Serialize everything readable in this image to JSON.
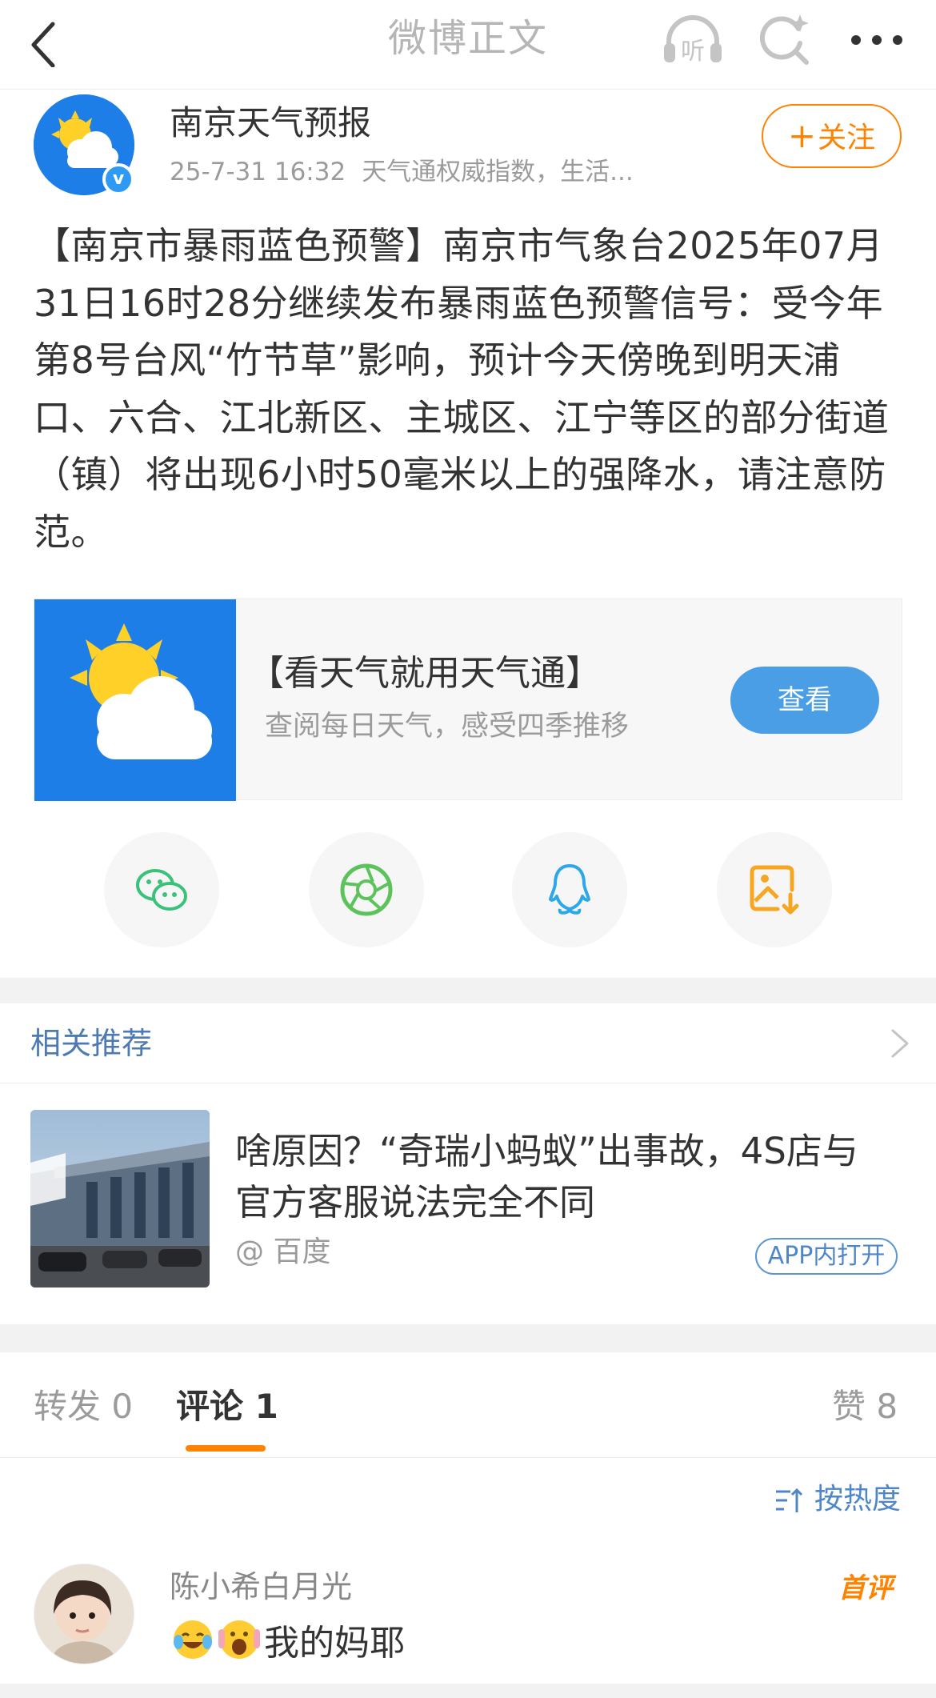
{
  "nav": {
    "title": "微博正文",
    "listen_label": "听"
  },
  "author": {
    "name": "南京天气预报",
    "time": "25-7-31 16:32",
    "source": "天气通权威指数，生活...",
    "verified_mark": "v",
    "follow_label": "关注",
    "follow_plus": "+"
  },
  "post": {
    "text": "【南京市暴雨蓝色预警】南京市气象台2025年07月31日16时28分继续发布暴雨蓝色预警信号：受今年第8号台风“竹节草”影响，预计今天傍晚到明天浦口、六合、江北新区、主城区、江宁等区的部分街道（镇）将出现6小时50毫米以上的强降水，请注意防范。"
  },
  "link_card": {
    "title": "【看天气就用天气通】",
    "subtitle": "查阅每日天气，感受四季推移",
    "button_label": "查看"
  },
  "share": {
    "items": [
      "wechat-icon",
      "moments-icon",
      "qq-icon",
      "save-image-icon"
    ]
  },
  "related": {
    "title": "相关推荐",
    "item": {
      "headline": "啥原因？“奇瑞小蚂蚁”出事故，4S店与官方客服说法完全不同",
      "source": "@ 百度",
      "open_label": "APP内打开"
    }
  },
  "tabs": {
    "repost": "转发 0",
    "comment": "评论 1",
    "like": "赞 8"
  },
  "comments": {
    "sort_label": "按热度",
    "items": [
      {
        "user": "陈小希白月光",
        "text": "我的妈耶",
        "badge": "首评"
      }
    ]
  },
  "colors": {
    "accent": "#ff8200",
    "link": "#4e7ab3",
    "weather_blue": "#1e7ee8",
    "button_blue": "#4a9ee6"
  }
}
